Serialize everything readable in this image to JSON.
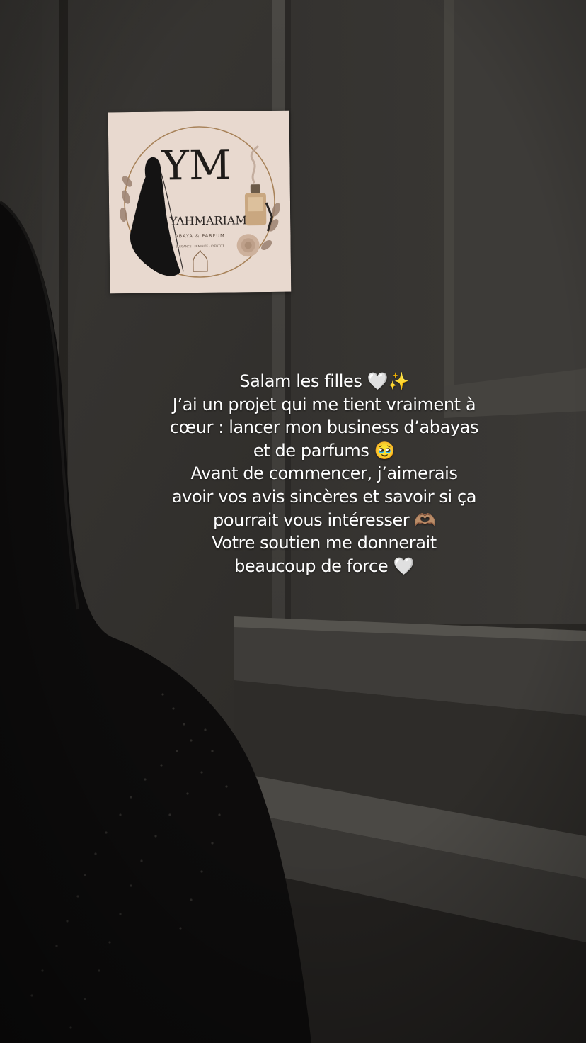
{
  "logo": {
    "monogram": "YM",
    "brand_name": "YAHMARIAM",
    "tagline": "ABAYA & PARFUM",
    "subtagline": "ÉLÉGANCE · FEMINITÉ · IDENTITÉ"
  },
  "caption": {
    "lines": [
      {
        "text": "Salam les filles",
        "emoji": "🤍✨"
      },
      {
        "text": "J’ai un projet qui me tient vraiment à",
        "emoji": ""
      },
      {
        "text": "cœur : lancer mon business d’abayas",
        "emoji": ""
      },
      {
        "text": "et de parfums",
        "emoji": "🥹"
      },
      {
        "text": "Avant de commencer, j’aimerais",
        "emoji": ""
      },
      {
        "text": "avoir vos avis sincères et savoir si ça",
        "emoji": ""
      },
      {
        "text": "pourrait vous intéresser",
        "emoji": "🫶🏽"
      },
      {
        "text": "Votre soutien me donnerait",
        "emoji": ""
      },
      {
        "text": "beaucoup de force",
        "emoji": "🤍"
      }
    ]
  },
  "colors": {
    "background": "#2c2a28",
    "caption_text": "#ffffff",
    "logo_background": "#e8d9cf",
    "logo_gold": "#a8835a"
  },
  "icons": {
    "heart": "white-heart-icon",
    "sparkles": "sparkles-icon",
    "pleading": "pleading-face-icon",
    "hands": "heart-hands-icon"
  }
}
